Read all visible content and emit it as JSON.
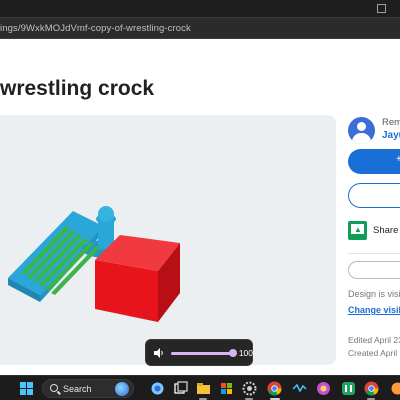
{
  "browser": {
    "url_fragment": "ings/9WxkMOJdVmf-copy-of-wrestling-crock"
  },
  "design": {
    "title": "wrestling crock"
  },
  "sidebar": {
    "remix_label": "Rem",
    "author_label": "Jayu",
    "share_label": "Share t",
    "visibility_text": "Design is visib",
    "change_visibility_link": "Change visibil",
    "edited_text": "Edited April 23",
    "created_text": "Created April 1"
  },
  "volume": {
    "level": "100",
    "fraction": 1.0,
    "accent_color": "#d9b4f0"
  },
  "taskbar": {
    "search_label": "Search",
    "icons": [
      "windows-start-icon",
      "search-icon",
      "copilot-icon",
      "task-view-icon",
      "file-explorer-icon",
      "store-icon",
      "settings-icon",
      "chrome-icon",
      "app-icon",
      "app-icon",
      "app-icon",
      "app-icon",
      "chrome-icon"
    ]
  },
  "colors": {
    "accent_blue": "#1a6fd6",
    "part_red": "#e8141c",
    "part_blue": "#2aa7d8",
    "part_green": "#39b54a"
  }
}
